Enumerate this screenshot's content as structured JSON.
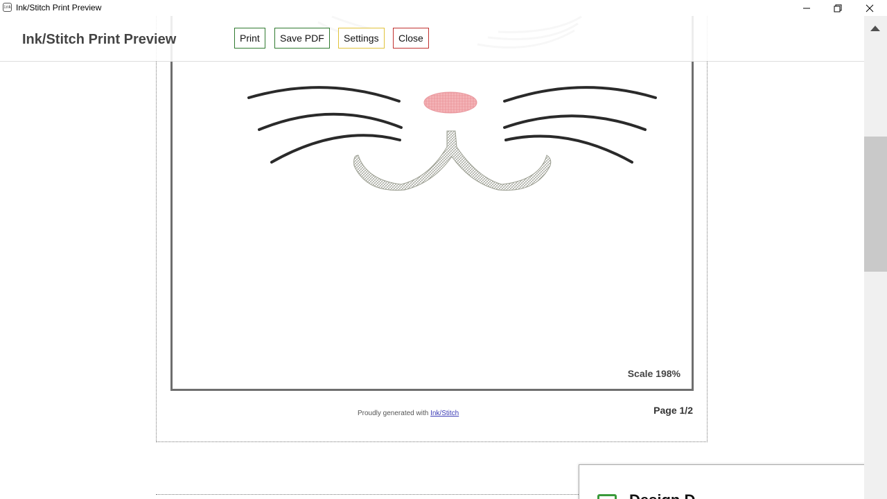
{
  "window": {
    "title": "Ink/Stitch Print Preview",
    "app_icon_text": "ink"
  },
  "header": {
    "title": "Ink/Stitch Print Preview",
    "buttons": {
      "print": "Print",
      "save_pdf": "Save PDF",
      "settings": "Settings",
      "close": "Close"
    },
    "button_colors": {
      "print": "#2f7a2f",
      "save_pdf": "#2f7a2f",
      "settings": "#e0c23a",
      "close": "#c0302f"
    }
  },
  "page": {
    "scale": "Scale 198%",
    "footer_prefix": "Proudly generated with ",
    "footer_link": "Ink/Stitch",
    "page_number": "Page 1/2"
  },
  "design": {
    "nose_color": "#f2a5aa",
    "whisker_color": "#2a2a2a",
    "mouth_color": "#b9bcb0",
    "eyelash_color": "#b8b8b8"
  },
  "settings_panel": {
    "heading": "Design D"
  }
}
